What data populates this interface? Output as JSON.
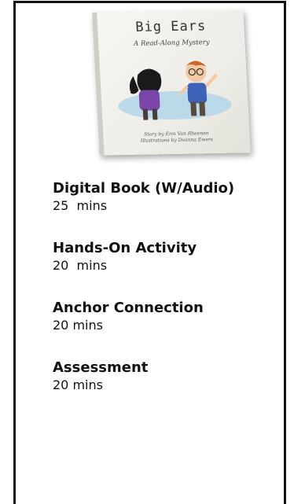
{
  "book": {
    "title": "Big Ears",
    "subtitle": "A Read-Along Mystery",
    "credit_story": "Story by Erin Van Rheenen",
    "credit_illustrations": "Illustrations by Deanna Ewers"
  },
  "items": [
    {
      "title": "Digital Book (W/Audio)",
      "duration": "25  mins"
    },
    {
      "title": "Hands-On Activity",
      "duration": "20  mins"
    },
    {
      "title": "Anchor Connection",
      "duration": "20 mins"
    },
    {
      "title": "Assessment",
      "duration": "20 mins"
    }
  ]
}
